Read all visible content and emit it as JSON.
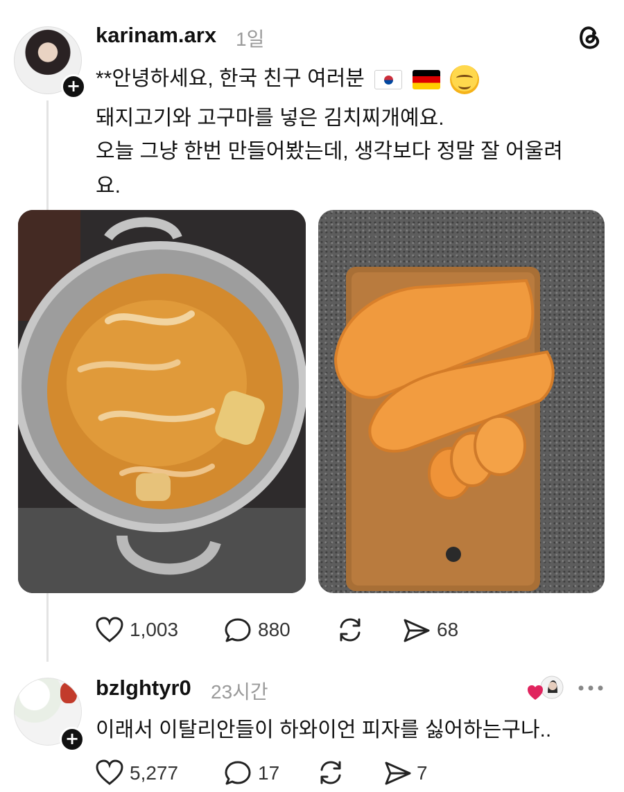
{
  "post": {
    "username": "karinam.arx",
    "time": "1일",
    "lines": [
      "**안녕하세요, 한국 친구 여러분",
      "돼지고기와 고구마를 넣은 김치찌개예요.",
      "오늘 그냥 한번 만들어봤는데, 생각보다 정말 잘 어울려",
      "요."
    ],
    "emojis": [
      "flag-south-korea",
      "flag-germany",
      "hugging-face"
    ],
    "images": [
      "kimchi-stew-pot-photo",
      "sweet-potato-cutting-board-photo"
    ],
    "actions": {
      "likes": "1,003",
      "comments": "880",
      "shares": "68"
    }
  },
  "reply": {
    "username": "bzlghtyr0",
    "time": "23시간",
    "text": "이래서 이탈리안들이 하와이언 피자를 싫어하는구나..",
    "actions": {
      "likes": "5,277",
      "comments": "17",
      "shares": "7"
    }
  },
  "colors": {
    "text": "#111111",
    "muted": "#9a9a9a",
    "like_heart": "#e0245e"
  }
}
